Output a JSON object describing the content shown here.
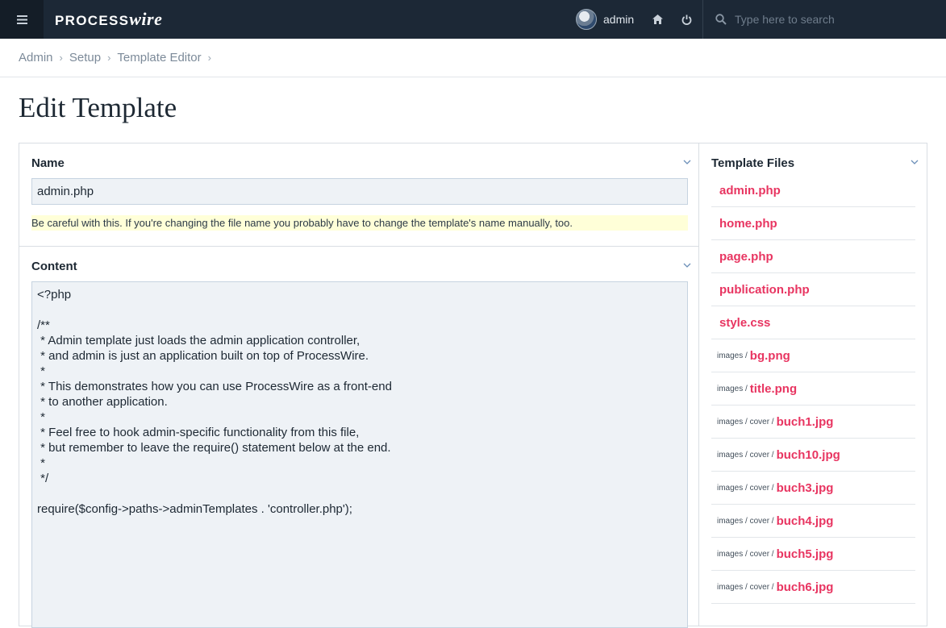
{
  "topbar": {
    "logo_a": "PROCESS",
    "logo_b": "wire",
    "user_name": "admin",
    "search_placeholder": "Type here to search"
  },
  "breadcrumb": [
    "Admin",
    "Setup",
    "Template Editor"
  ],
  "page_title": "Edit Template",
  "name_field": {
    "label": "Name",
    "value": "admin.php",
    "note": "Be careful with this. If you're changing the file name you probably have to change the template's name manually, too."
  },
  "content_field": {
    "label": "Content",
    "value": "<?php\n\n/**\n * Admin template just loads the admin application controller,\n * and admin is just an application built on top of ProcessWire.\n *\n * This demonstrates how you can use ProcessWire as a front-end\n * to another application.\n *\n * Feel free to hook admin-specific functionality from this file,\n * but remember to leave the require() statement below at the end.\n *\n */\n\nrequire($config->paths->adminTemplates . 'controller.php');"
  },
  "template_files": {
    "label": "Template Files",
    "files": [
      {
        "dir": "",
        "name": "admin.php"
      },
      {
        "dir": "",
        "name": "home.php"
      },
      {
        "dir": "",
        "name": "page.php"
      },
      {
        "dir": "",
        "name": "publication.php"
      },
      {
        "dir": "",
        "name": "style.css"
      },
      {
        "dir": "images /",
        "name": "bg.png"
      },
      {
        "dir": "images /",
        "name": "title.png"
      },
      {
        "dir": "images / cover /",
        "name": "buch1.jpg"
      },
      {
        "dir": "images / cover /",
        "name": "buch10.jpg"
      },
      {
        "dir": "images / cover /",
        "name": "buch3.jpg"
      },
      {
        "dir": "images / cover /",
        "name": "buch4.jpg"
      },
      {
        "dir": "images / cover /",
        "name": "buch5.jpg"
      },
      {
        "dir": "images / cover /",
        "name": "buch6.jpg"
      }
    ]
  },
  "colors": {
    "topbar_bg": "#1c2836",
    "accent_link": "#e83561",
    "notes_bg": "#ffffd8",
    "input_bg": "#eef2f6"
  },
  "icons": [
    "menu-icon",
    "avatar",
    "home-icon",
    "power-icon",
    "search-icon",
    "chevron-down-icon"
  ]
}
